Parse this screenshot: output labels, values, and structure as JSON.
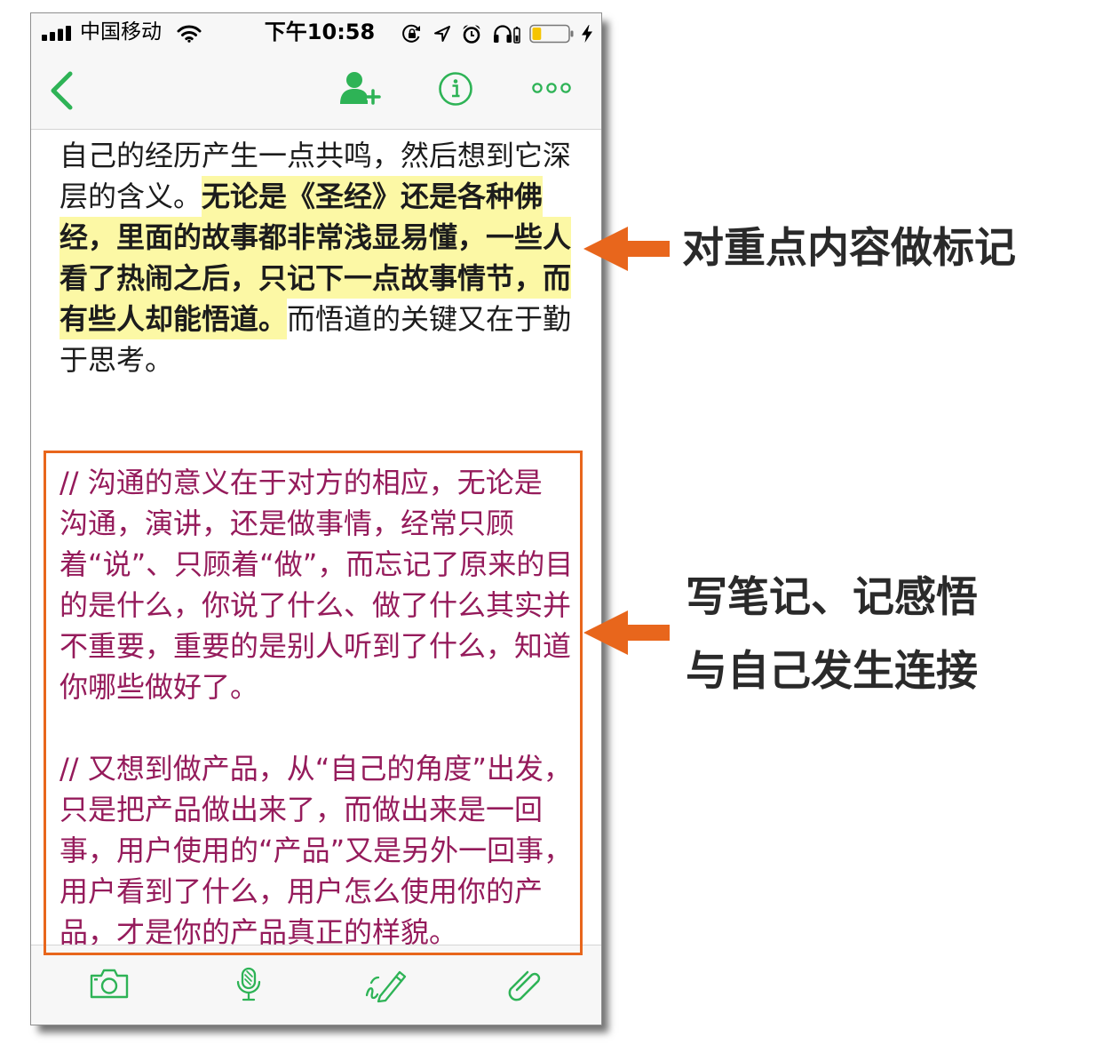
{
  "accent_color": "#2eb356",
  "status_bar": {
    "carrier": "中国移动",
    "time": "下午10:58",
    "battery_level": 0.25,
    "battery_color": "#f5c400",
    "icons": [
      "signal-icon",
      "wifi-icon",
      "rotation-lock-icon",
      "location-icon",
      "alarm-icon",
      "headphones-icon",
      "battery-icon",
      "charging-icon"
    ]
  },
  "nav_bar": {
    "icons": [
      "back-icon",
      "add-person-icon",
      "info-icon",
      "more-icon"
    ]
  },
  "note": {
    "text_color": "#1c1c1c",
    "highlight_color": "#fcf8a5",
    "lines": [
      [
        {
          "text": "自己的经历产生一点共鸣，然后想到它深",
          "highlighted": false
        }
      ],
      [
        {
          "text": "层的含义。",
          "highlighted": false
        },
        {
          "text": "无论是《圣经》还是各种佛",
          "highlighted": true
        }
      ],
      [
        {
          "text": "经，里面的故事都非常浅显易懂，一些人",
          "highlighted": true
        }
      ],
      [
        {
          "text": "看了热闹之后，只记下一点故事情节，而",
          "highlighted": true
        }
      ],
      [
        {
          "text": "有些人却能悟道。",
          "highlighted": true
        },
        {
          "text": "而悟道的关键又在于勤",
          "highlighted": false
        }
      ],
      [
        {
          "text": "于思考。",
          "highlighted": false
        }
      ]
    ]
  },
  "comment": {
    "text_color": "#951b5b",
    "paragraphs": [
      [
        "// 沟通的意义在于对方的相应，无论是",
        "沟通，演讲，还是做事情，经常只顾",
        "着“说”、只顾着“做”，而忘记了原来的目",
        "的是什么，你说了什么、做了什么其实并",
        "不重要，重要的是别人听到了什么，知道",
        "你哪些做好了。"
      ],
      [
        "// 又想到做产品，从“自己的角度”出发，",
        "只是把产品做出来了，而做出来是一回",
        "事，用户使用的“产品”又是另外一回事，",
        "用户看到了什么，用户怎么使用你的产",
        "品，才是你的产品真正的样貌。"
      ]
    ]
  },
  "toolbar": {
    "icons": [
      "camera-icon",
      "microphone-icon",
      "handwriting-icon",
      "attachment-icon"
    ]
  },
  "annotations": {
    "color": "#e8661c",
    "highlight_label": "对重点内容做标记",
    "comment_label": [
      "写笔记、记感悟",
      "与自己发生连接"
    ]
  }
}
